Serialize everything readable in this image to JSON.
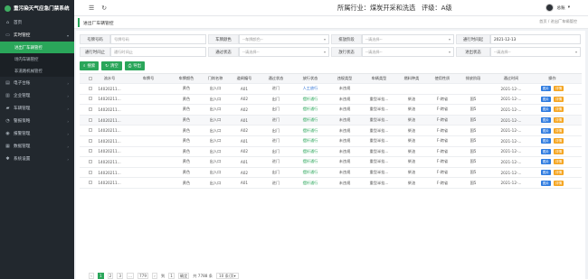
{
  "app": {
    "title": "重污染天气应急门禁系统"
  },
  "header": {
    "industry_label": "所属行业：",
    "industry": "煤炭开采和洗选",
    "rating_label": "评级：",
    "rating": "A级",
    "user": "总账"
  },
  "tab": {
    "label": "进出厂车辆管控"
  },
  "breadcrumb": {
    "home": "首页",
    "sep": "/",
    "current": "进出厂车辆管控"
  },
  "sidebar": {
    "items": [
      {
        "label": "首页",
        "icon": "home-icon"
      },
      {
        "label": "实时管控",
        "icon": "monitor-icon",
        "open": true,
        "children": [
          {
            "label": "进出厂车辆管控",
            "active": true
          },
          {
            "label": "场内车辆管控",
            "active": false
          },
          {
            "label": "非道路机械管控",
            "active": false
          }
        ]
      },
      {
        "label": "电子台账",
        "icon": "book-icon"
      },
      {
        "label": "企业管理",
        "icon": "building-icon"
      },
      {
        "label": "车辆管理",
        "icon": "truck-icon"
      },
      {
        "label": "警报策略",
        "icon": "bell-icon"
      },
      {
        "label": "报警管理",
        "icon": "alarm-icon"
      },
      {
        "label": "数据管理",
        "icon": "database-icon"
      },
      {
        "label": "系统设置",
        "icon": "gear-icon"
      }
    ]
  },
  "filters": {
    "plate_label": "号牌号码",
    "plate_placeholder": "号牌号码",
    "color_label": "车牌颜色",
    "color_placeholder": "--车牌颜色--",
    "stage_label": "排放阶段",
    "stage_placeholder": "--请选择--",
    "start_label": "通行时间起",
    "start_value": "2021-12-13",
    "end_label": "通行时间止",
    "end_placeholder": "通行时间止",
    "pass_label": "通过状态",
    "pass_placeholder": "--请选择--",
    "release_label": "放行状态",
    "release_placeholder": "--请选择--",
    "inout_label": "进出状态",
    "inout_placeholder": "--请选择--"
  },
  "buttons": {
    "search": "搜索",
    "reset": "清空",
    "export": "导出"
  },
  "table": {
    "columns": [
      "流水号",
      "车牌号",
      "车牌颜色",
      "门岗名称",
      "道闸编号",
      "通过状态",
      "放行状态",
      "违规类型",
      "车辆类型",
      "燃料种类",
      "使用性质",
      "排放阶段",
      "通过时间",
      "操作"
    ],
    "op_detail": "图片",
    "op_edit": "详情",
    "rows": [
      [
        "14020211...",
        "",
        "黄色",
        "出入口",
        "A01",
        "进门",
        "人工放行",
        "未违规",
        "",
        "",
        "",
        "",
        "2021-12-...",
        ""
      ],
      [
        "14020211...",
        "",
        "黄色",
        "出入口",
        "A02",
        "出门",
        "摆杆通行",
        "未违规",
        "重型半挂...",
        "柴油",
        "F-跨省",
        "国5",
        "2021-12-...",
        ""
      ],
      [
        "14020211...",
        "",
        "黄色",
        "出入口",
        "A02",
        "出门",
        "摆杆通行",
        "未违规",
        "重型半挂...",
        "柴油",
        "F-跨省",
        "国5",
        "2021-12-...",
        ""
      ],
      [
        "14020211...",
        "",
        "黄色",
        "出入口",
        "A01",
        "进门",
        "摆杆通行",
        "未违规",
        "重型半挂...",
        "柴油",
        "F-跨省",
        "国5",
        "2021-12-...",
        ""
      ],
      [
        "14020211...",
        "",
        "黄色",
        "出入口",
        "A02",
        "出门",
        "摆杆通行",
        "未违规",
        "重型半挂...",
        "柴油",
        "F-跨省",
        "国5",
        "2021-12-...",
        ""
      ],
      [
        "14020211...",
        "",
        "黄色",
        "出入口",
        "A01",
        "进门",
        "摆杆通行",
        "未违规",
        "重型半挂...",
        "柴油",
        "F-跨省",
        "国5",
        "2021-12-...",
        ""
      ],
      [
        "14020211...",
        "",
        "黄色",
        "出入口",
        "A02",
        "出门",
        "摆杆通行",
        "未违规",
        "重型半挂...",
        "柴油",
        "F-跨省",
        "国5",
        "2021-12-...",
        ""
      ],
      [
        "14020211...",
        "",
        "黄色",
        "出入口",
        "A01",
        "进门",
        "摆杆通行",
        "未违规",
        "重型半挂...",
        "柴油",
        "F-跨省",
        "国5",
        "2021-12-...",
        ""
      ],
      [
        "14020211...",
        "",
        "黄色",
        "出入口",
        "A02",
        "出门",
        "摆杆通行",
        "未违规",
        "重型半挂...",
        "柴油",
        "F-跨省",
        "国5",
        "2021-12-...",
        ""
      ],
      [
        "14020211...",
        "",
        "黄色",
        "出入口",
        "A01",
        "进门",
        "摆杆通行",
        "未违规",
        "重型半挂...",
        "柴油",
        "F-跨省",
        "国5",
        "2021-12-...",
        ""
      ]
    ]
  },
  "pagination": {
    "prev": "‹",
    "pages": [
      "1",
      "2",
      "3",
      "...",
      "779"
    ],
    "next": "›",
    "goto": "到",
    "page": "1",
    "confirm": "确定",
    "total": "共 7788 条",
    "size": "10 条/页"
  }
}
